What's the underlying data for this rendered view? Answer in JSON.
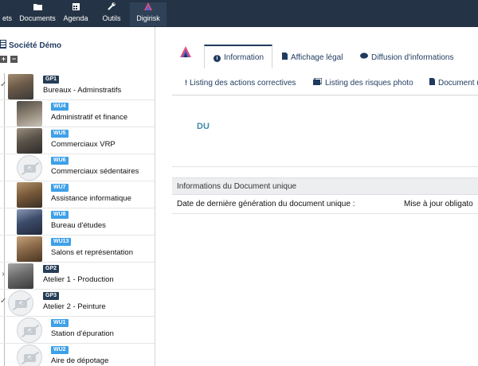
{
  "nav": {
    "items": [
      {
        "label": "ets",
        "icon": "partial-icon"
      },
      {
        "label": "Documents",
        "icon": "folder-icon"
      },
      {
        "label": "Agenda",
        "icon": "calendar-icon"
      },
      {
        "label": "Outils",
        "icon": "wrench-icon"
      },
      {
        "label": "Digirisk",
        "icon": "digirisk-logo-icon",
        "active": true
      }
    ]
  },
  "sidebar": {
    "society": "Société Démo",
    "tree": [
      {
        "ref": "GP1",
        "type": "group",
        "name": "Bureaux - Adminstratifs",
        "thumb": "photo"
      },
      {
        "ref": "WU4",
        "type": "unit",
        "name": "Administratif et finance",
        "thumb": "photo"
      },
      {
        "ref": "WU5",
        "type": "unit",
        "name": "Commerciaux VRP",
        "thumb": "photo"
      },
      {
        "ref": "WU6",
        "type": "unit",
        "name": "Commerciaux sédentaires",
        "thumb": "none"
      },
      {
        "ref": "WU7",
        "type": "unit",
        "name": "Assistance informatique",
        "thumb": "photo"
      },
      {
        "ref": "WU8",
        "type": "unit",
        "name": "Bureau d'études",
        "thumb": "photo"
      },
      {
        "ref": "WU13",
        "type": "unit",
        "name": "Salons et représentation",
        "thumb": "photo"
      },
      {
        "ref": "GP2",
        "type": "group",
        "name": "Atelier 1 - Production",
        "thumb": "photo"
      },
      {
        "ref": "GP3",
        "type": "group",
        "name": "Atelier 2 - Peinture",
        "thumb": "none"
      },
      {
        "ref": "WU1",
        "type": "unit",
        "name": "Station d'épuration",
        "thumb": "none"
      },
      {
        "ref": "WU2",
        "type": "unit",
        "name": "Aire de dépotage",
        "thumb": "none"
      }
    ]
  },
  "main": {
    "tabs_row1": [
      {
        "label": "Information",
        "icon": "info-icon",
        "active": true
      },
      {
        "label": "Affichage légal",
        "icon": "document-icon"
      },
      {
        "label": "Diffusion d'informations",
        "icon": "chat-icon"
      }
    ],
    "tabs_row2": [
      {
        "label": "Listing des actions correctives",
        "icon": "exclamation-icon"
      },
      {
        "label": "Listing des risques photo",
        "icon": "images-icon"
      },
      {
        "label": "Document u",
        "icon": "document-icon"
      }
    ],
    "heading": "DU",
    "info_table": {
      "header": "Informations du Document unique",
      "rows": [
        {
          "key": "Date de dernière génération du document unique :",
          "value": "Mise à jour obligato"
        }
      ]
    }
  }
}
